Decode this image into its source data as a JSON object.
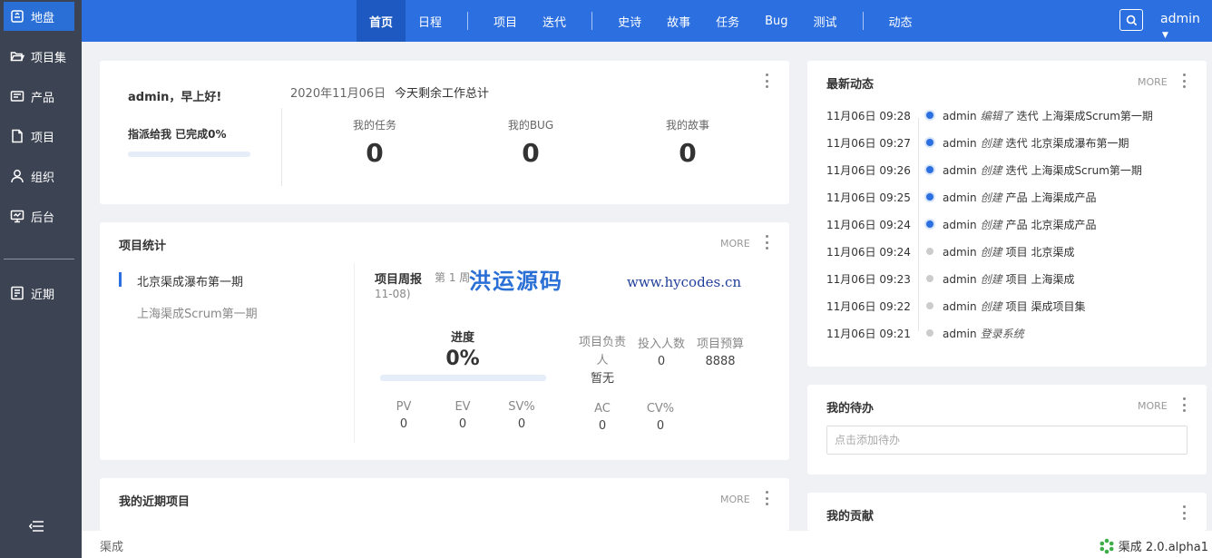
{
  "sidebar": {
    "items": [
      {
        "label": "地盘",
        "icon": "home-icon",
        "active": true
      },
      {
        "label": "项目集",
        "icon": "folder-open-icon"
      },
      {
        "label": "产品",
        "icon": "product-icon"
      },
      {
        "label": "项目",
        "icon": "file-icon"
      },
      {
        "label": "组织",
        "icon": "user-icon"
      },
      {
        "label": "后台",
        "icon": "monitor-icon"
      },
      {
        "label": "近期",
        "icon": "recent-icon"
      }
    ]
  },
  "topnav": {
    "items": [
      "首页",
      "日程",
      "项目",
      "迭代",
      "史诗",
      "故事",
      "任务",
      "Bug",
      "测试",
      "动态"
    ],
    "user": "admin"
  },
  "greeting": {
    "title": "admin，早上好!",
    "assigned": "指派给我 已完成0%",
    "date": "2020年11月06日",
    "summary": "今天剩余工作总计",
    "stats": [
      {
        "label": "我的任务",
        "value": "0"
      },
      {
        "label": "我的BUG",
        "value": "0"
      },
      {
        "label": "我的故事",
        "value": "0"
      }
    ]
  },
  "project_stats": {
    "title": "项目统计",
    "more": "MORE",
    "projects": [
      "北京渠成瀑布第一期",
      "上海渠成Scrum第一期"
    ],
    "weekly_label": "项目周报",
    "week_text": "第 1 周",
    "week_date": "11-08)",
    "progress_label": "进度",
    "progress_value": "0%",
    "progress_fraction": 0,
    "metrics": [
      {
        "label": "项目负责人",
        "value": "暂无"
      },
      {
        "label": "投入人数",
        "value": "0"
      },
      {
        "label": "项目预算",
        "value": "8888"
      }
    ],
    "ev": [
      {
        "label": "PV",
        "value": "0"
      },
      {
        "label": "EV",
        "value": "0"
      },
      {
        "label": "SV%",
        "value": "0"
      },
      {
        "label": "AC",
        "value": "0"
      },
      {
        "label": "CV%",
        "value": "0"
      }
    ]
  },
  "recent_projects": {
    "title": "我的近期项目",
    "more": "MORE"
  },
  "activity": {
    "title": "最新动态",
    "more": "MORE",
    "items": [
      {
        "time": "11月06日 09:28",
        "user": "admin",
        "action": "编辑了",
        "object": "迭代 上海渠成Scrum第一期",
        "highlight": true
      },
      {
        "time": "11月06日 09:27",
        "user": "admin",
        "action": "创建",
        "object": "迭代 北京渠成瀑布第一期",
        "highlight": true
      },
      {
        "time": "11月06日 09:26",
        "user": "admin",
        "action": "创建",
        "object": "迭代 上海渠成Scrum第一期",
        "highlight": true
      },
      {
        "time": "11月06日 09:25",
        "user": "admin",
        "action": "创建",
        "object": "产品 上海渠成产品",
        "highlight": true
      },
      {
        "time": "11月06日 09:24",
        "user": "admin",
        "action": "创建",
        "object": "产品 北京渠成产品",
        "highlight": true
      },
      {
        "time": "11月06日 09:24",
        "user": "admin",
        "action": "创建",
        "object": "项目 北京渠成",
        "highlight": false
      },
      {
        "time": "11月06日 09:23",
        "user": "admin",
        "action": "创建",
        "object": "项目 上海渠成",
        "highlight": false
      },
      {
        "time": "11月06日 09:22",
        "user": "admin",
        "action": "创建",
        "object": "项目 渠成项目集",
        "highlight": false
      },
      {
        "time": "11月06日 09:21",
        "user": "admin",
        "action": "登录系统",
        "object": "",
        "highlight": false
      }
    ]
  },
  "todo": {
    "title": "我的待办",
    "more": "MORE",
    "placeholder": "点击添加待办"
  },
  "contribution": {
    "title": "我的贡献"
  },
  "watermark": {
    "cn": "洪运源码",
    "url": "www.hycodes.cn"
  },
  "footer": {
    "left": "渠成",
    "version": "渠成 2.0.alpha1"
  },
  "colors": {
    "primary": "#2b6fe0",
    "sidebar": "#3c4353",
    "background": "#eff1f4"
  }
}
